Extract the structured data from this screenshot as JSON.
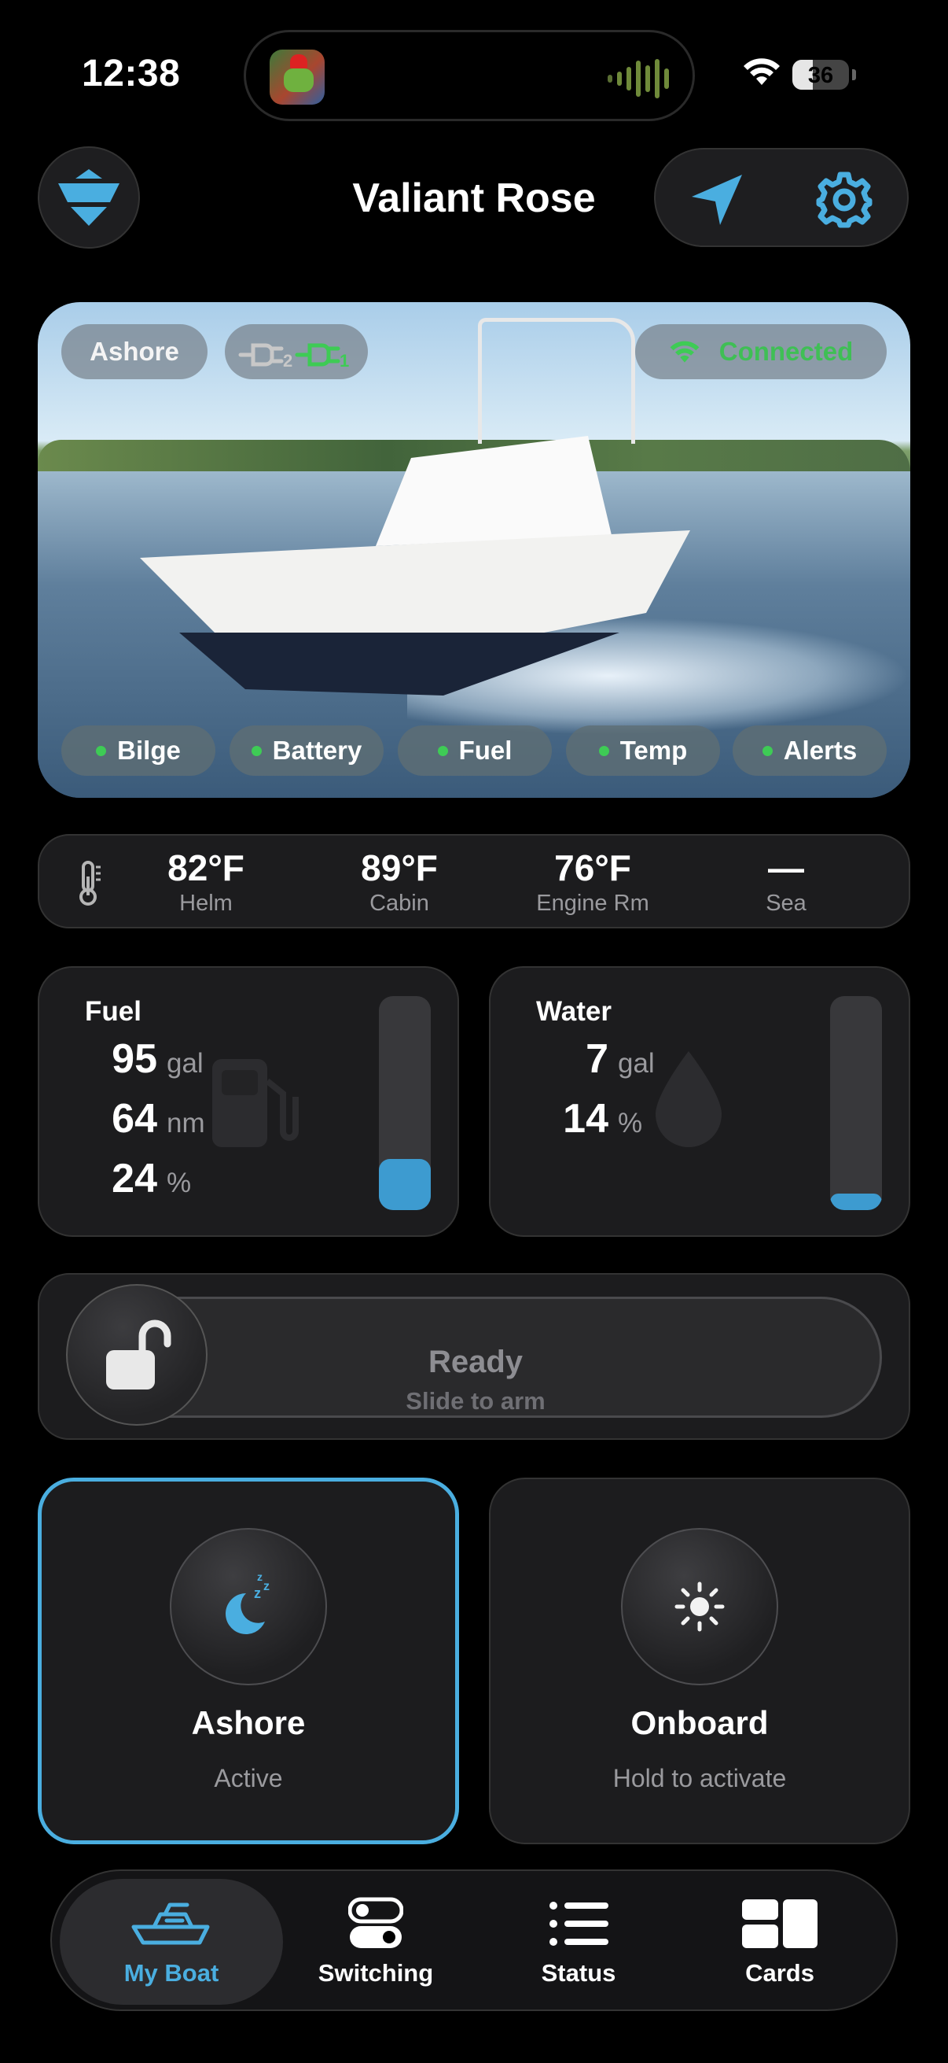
{
  "status_bar": {
    "time": "12:38",
    "battery": "36"
  },
  "header": {
    "title": "Valiant Rose"
  },
  "hero": {
    "mode_chip": "Ashore",
    "shore_power": {
      "left": "2",
      "right": "1"
    },
    "connection": "Connected",
    "indicators": [
      {
        "label": "Bilge"
      },
      {
        "label": "Battery"
      },
      {
        "label": "Fuel"
      },
      {
        "label": "Temp"
      },
      {
        "label": "Alerts"
      }
    ]
  },
  "temperatures": [
    {
      "value": "82°F",
      "label": "Helm"
    },
    {
      "value": "89°F",
      "label": "Cabin"
    },
    {
      "value": "76°F",
      "label": "Engine Rm"
    },
    {
      "value": "—",
      "label": "Sea"
    }
  ],
  "fuel": {
    "title": "Fuel",
    "rows": [
      {
        "value": "95",
        "unit": "gal"
      },
      {
        "value": "64",
        "unit": "nm"
      },
      {
        "value": "24",
        "unit": "%"
      }
    ],
    "level_percent": 24
  },
  "water": {
    "title": "Water",
    "rows": [
      {
        "value": "7",
        "unit": "gal"
      },
      {
        "value": "14",
        "unit": "%"
      }
    ],
    "level_percent": 14
  },
  "arm": {
    "title": "Ready",
    "subtitle": "Slide to arm"
  },
  "modes": [
    {
      "name": "Ashore",
      "state": "Active"
    },
    {
      "name": "Onboard",
      "state": "Hold to activate"
    }
  ],
  "tabs": [
    {
      "label": "My Boat"
    },
    {
      "label": "Switching"
    },
    {
      "label": "Status"
    },
    {
      "label": "Cards"
    }
  ],
  "colors": {
    "accent": "#4aaee0",
    "ok": "#3ecb55",
    "gauge": "#3d9bd0"
  }
}
